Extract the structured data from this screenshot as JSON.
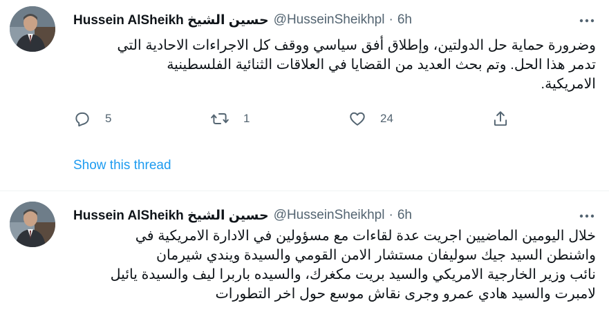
{
  "colors": {
    "link": "#1d9bf0",
    "secondary_text": "#536471",
    "primary_text": "#0f1419",
    "divider": "#eff3f4"
  },
  "tweets": [
    {
      "author_name": "Hussein AlSheikh حسين الشيخ",
      "handle": "@HusseinSheikhpl",
      "separator": "·",
      "time": "6h",
      "more_icon": "more-horizontal-icon",
      "lines": [
        "وضرورة حماية حل الدولتين، وإطلاق أفق سياسي ووقف كل الاجراءات الاحادية التي",
        "تدمر هذا الحل. وتم بحث العديد من القضايا في العلاقات الثنائية الفلسطينية",
        "الامريكية."
      ],
      "actions": {
        "reply_count": "5",
        "retweet_count": "1",
        "like_count": "24"
      },
      "show_thread": "Show this thread"
    },
    {
      "author_name": "Hussein AlSheikh حسين الشيخ",
      "handle": "@HusseinSheikhpl",
      "separator": "·",
      "time": "6h",
      "more_icon": "more-horizontal-icon",
      "lines": [
        "خلال اليومين الماضيين اجريت عدة لقاءات مع مسؤولين في الادارة الامريكية في",
        "واشنطن  السيد جيك سوليفان مستشار الامن القومي والسيدة ويندي شيرمان",
        "نائب وزير الخارجية الامريكي والسيد بريت مكغرك، والسيده باربرا ليف والسيدة يائيل",
        "لامبرت والسيد هادي عمرو وجرى نقاش موسع حول اخر التطورات"
      ]
    }
  ]
}
